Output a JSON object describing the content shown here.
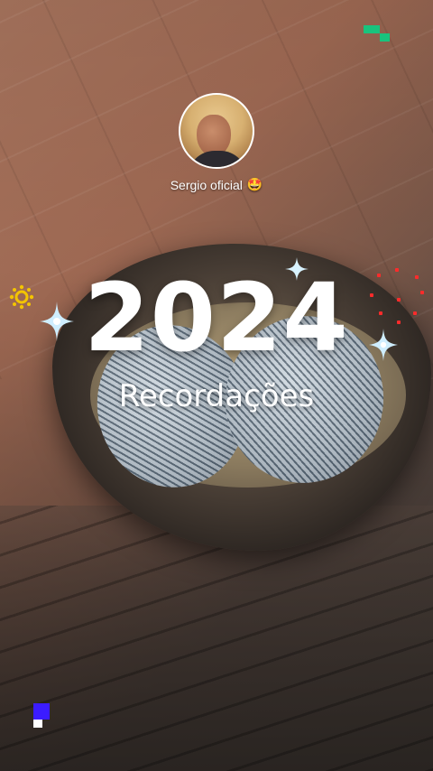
{
  "profile": {
    "name": "Sergio oficial",
    "name_emoji": "🤩"
  },
  "headline": {
    "year": "2024",
    "subtitle": "Recordações"
  },
  "decorations": {
    "sparkle_icon": "sparkle-icon",
    "sun_icon": "sun-icon",
    "confetti_color": "#ff2b2b",
    "corner_accent_colors": [
      "#19c37d",
      "#3b1cff",
      "#ffffff"
    ]
  }
}
